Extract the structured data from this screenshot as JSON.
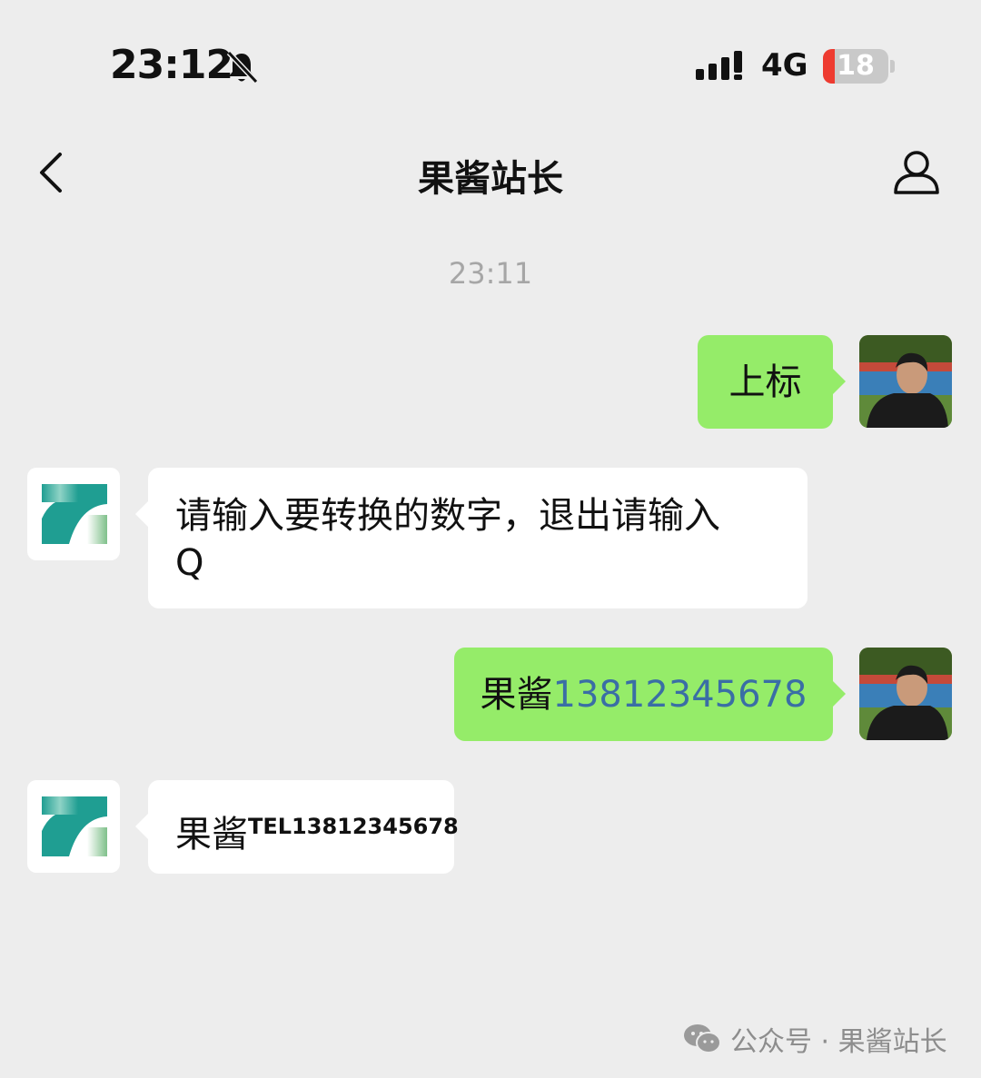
{
  "status_bar": {
    "time": "23:12",
    "network": "4G",
    "battery": "18",
    "battery_level": 0.18
  },
  "nav": {
    "title": "果酱站长"
  },
  "chat": {
    "timestamp": "23:11",
    "messages": [
      {
        "sender": "me",
        "text": "上标"
      },
      {
        "sender": "bot",
        "line1": "请输入要转换的数字，退出请输入",
        "line2": "Q"
      },
      {
        "sender": "me",
        "prefix": "果酱",
        "number": "13812345678"
      },
      {
        "sender": "bot",
        "prefix": "果酱",
        "superscript": "TEL13812345678"
      }
    ]
  },
  "footer": {
    "text": "公众号 · 果酱站长"
  },
  "colors": {
    "background": "#ededed",
    "bubble_green": "#95ec69",
    "bubble_white": "#ffffff",
    "link_blue": "#3a6ea5",
    "logo_teal": "#1f9e92"
  }
}
